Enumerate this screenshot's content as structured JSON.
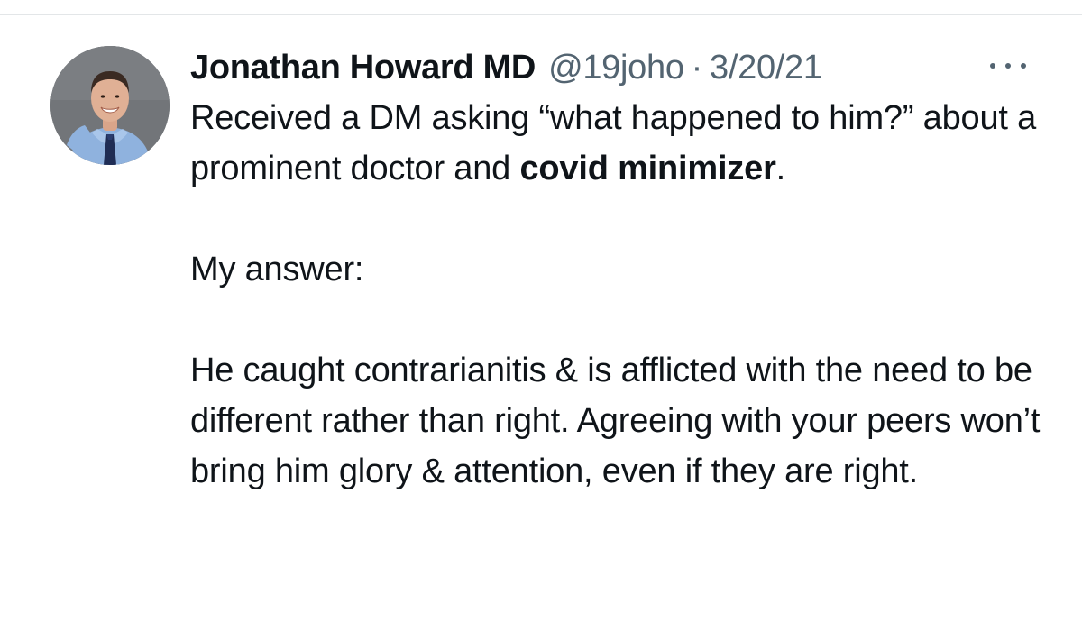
{
  "tweet": {
    "author": {
      "display_name": "Jonathan Howard MD",
      "handle": "@19joho",
      "avatar_icon": "profile-photo"
    },
    "separator": "·",
    "date": "3/20/21",
    "more_icon": "more-horizontal-icon",
    "text": {
      "p1_part1": "Received a DM asking “what happened to him?” about a prominent doctor and ",
      "p1_bold": "covid minimizer",
      "p1_part2": ".",
      "p2": "My answer:",
      "p3": "He caught contrarianitis & is afflicted with the need to be different rather than right. Agreeing with your peers won’t bring him glory & attention, even if they are right."
    }
  },
  "colors": {
    "text_primary": "#0f1419",
    "text_secondary": "#536471",
    "divider": "#e3e6e8",
    "background": "#ffffff"
  }
}
